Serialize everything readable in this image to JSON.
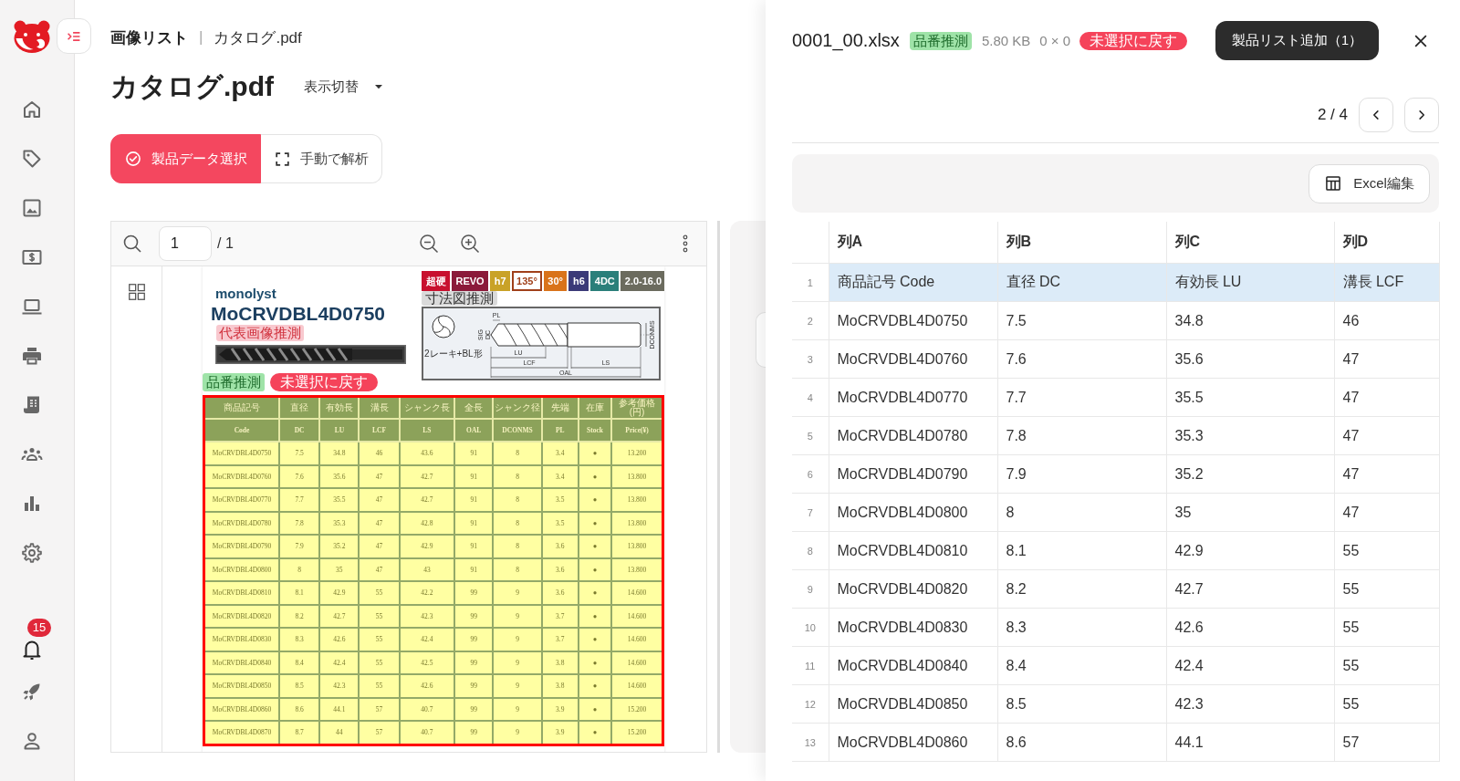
{
  "sidebar": {
    "notification_badge": "15"
  },
  "breadcrumb": {
    "parent": "画像リスト",
    "separator": "|",
    "current": "カタログ.pdf"
  },
  "header": {
    "title": "カタログ.pdf",
    "view_switch": "表示切替"
  },
  "mode_buttons": [
    {
      "label": "製品データ選択",
      "selected": true
    },
    {
      "label": "手動で解析",
      "selected": false
    }
  ],
  "pdf_viewer": {
    "page_input": "1",
    "page_total": "/ 1"
  },
  "catalog": {
    "brand": "monolyst",
    "product_code": "MoCRVDBL4D0750",
    "image_tag": "代表画像推測",
    "spec_badges": [
      {
        "text": "超硬",
        "color": "#c8102e",
        "kind": "solid"
      },
      {
        "text": "REVO",
        "color": "#8b1a3a",
        "kind": "solid"
      },
      {
        "text": "h7",
        "color": "#c9a227",
        "kind": "solid"
      },
      {
        "text": "135°",
        "color": "#a0401a",
        "kind": "outline"
      },
      {
        "text": "30°",
        "color": "#d9731a",
        "kind": "solid"
      },
      {
        "text": "h6",
        "color": "#3b3a78",
        "kind": "solid"
      },
      {
        "text": "4DC",
        "color": "#2a7f7a",
        "kind": "solid"
      },
      {
        "text": "2.0-16.0",
        "color": "#6b6b5e",
        "kind": "solid"
      }
    ],
    "drawing_tag": "寸法図推測",
    "drawing_labels": [
      "PL",
      "SIG",
      "DC",
      "DCONMS",
      "LU",
      "LCF",
      "LS",
      "OAL",
      "2レーキ+BL形"
    ],
    "part_tag": "品番推測",
    "reset_button": "未選択に戻す",
    "table": {
      "header_ja": [
        "商品記号",
        "直径",
        "有効長",
        "溝長",
        "シャンク長",
        "全長",
        "シャンク径",
        "先端",
        "在庫",
        "参考価格(円)"
      ],
      "header_en": [
        "Code",
        "DC",
        "LU",
        "LCF",
        "LS",
        "OAL",
        "DCONMS",
        "PL",
        "Stock",
        "Price(¥)"
      ],
      "rows": [
        [
          "MoCRVDBL4D0750",
          "7.5",
          "34.8",
          "46",
          "43.6",
          "91",
          "8",
          "3.4",
          "●",
          "13.200"
        ],
        [
          "MoCRVDBL4D0760",
          "7.6",
          "35.6",
          "47",
          "42.7",
          "91",
          "8",
          "3.4",
          "●",
          "13.800"
        ],
        [
          "MoCRVDBL4D0770",
          "7.7",
          "35.5",
          "47",
          "42.7",
          "91",
          "8",
          "3.5",
          "●",
          "13.800"
        ],
        [
          "MoCRVDBL4D0780",
          "7.8",
          "35.3",
          "47",
          "42.8",
          "91",
          "8",
          "3.5",
          "●",
          "13.800"
        ],
        [
          "MoCRVDBL4D0790",
          "7.9",
          "35.2",
          "47",
          "42.9",
          "91",
          "8",
          "3.6",
          "●",
          "13.800"
        ],
        [
          "MoCRVDBL4D0800",
          "8",
          "35",
          "47",
          "43",
          "91",
          "8",
          "3.6",
          "●",
          "13.800"
        ],
        [
          "MoCRVDBL4D0810",
          "8.1",
          "42.9",
          "55",
          "42.2",
          "99",
          "9",
          "3.6",
          "●",
          "14.600"
        ],
        [
          "MoCRVDBL4D0820",
          "8.2",
          "42.7",
          "55",
          "42.3",
          "99",
          "9",
          "3.7",
          "●",
          "14.600"
        ],
        [
          "MoCRVDBL4D0830",
          "8.3",
          "42.6",
          "55",
          "42.4",
          "99",
          "9",
          "3.7",
          "●",
          "14.600"
        ],
        [
          "MoCRVDBL4D0840",
          "8.4",
          "42.4",
          "55",
          "42.5",
          "99",
          "9",
          "3.8",
          "●",
          "14.600"
        ],
        [
          "MoCRVDBL4D0850",
          "8.5",
          "42.3",
          "55",
          "42.6",
          "99",
          "9",
          "3.8",
          "●",
          "14.600"
        ],
        [
          "MoCRVDBL4D0860",
          "8.6",
          "44.1",
          "57",
          "40.7",
          "99",
          "9",
          "3.9",
          "●",
          "15.200"
        ],
        [
          "MoCRVDBL4D0870",
          "8.7",
          "44",
          "57",
          "40.7",
          "99",
          "9",
          "3.9",
          "●",
          "15.200"
        ]
      ]
    }
  },
  "detail_panel": {
    "file_name": "0001_00.xlsx",
    "tag": "品番推測",
    "size": "5.80 KB",
    "dimensions": "0 × 0",
    "reset_button": "未選択に戻す",
    "add_button": "製品リスト追加（1）",
    "pagination": "2 / 4",
    "excel_button": "Excel編集",
    "sheet": {
      "columns": [
        "列A",
        "列B",
        "列C",
        "列D"
      ],
      "rows": [
        {
          "number": "1",
          "selected": true,
          "cells": [
            "商品記号 Code",
            "直径 DC",
            "有効長 LU",
            "溝長 LCF"
          ]
        },
        {
          "number": "2",
          "selected": false,
          "cells": [
            "MoCRVDBL4D0750",
            "7.5",
            "34.8",
            "46"
          ]
        },
        {
          "number": "3",
          "selected": false,
          "cells": [
            "MoCRVDBL4D0760",
            "7.6",
            "35.6",
            "47"
          ]
        },
        {
          "number": "4",
          "selected": false,
          "cells": [
            "MoCRVDBL4D0770",
            "7.7",
            "35.5",
            "47"
          ]
        },
        {
          "number": "5",
          "selected": false,
          "cells": [
            "MoCRVDBL4D0780",
            "7.8",
            "35.3",
            "47"
          ]
        },
        {
          "number": "6",
          "selected": false,
          "cells": [
            "MoCRVDBL4D0790",
            "7.9",
            "35.2",
            "47"
          ]
        },
        {
          "number": "7",
          "selected": false,
          "cells": [
            "MoCRVDBL4D0800",
            "8",
            "35",
            "47"
          ]
        },
        {
          "number": "8",
          "selected": false,
          "cells": [
            "MoCRVDBL4D0810",
            "8.1",
            "42.9",
            "55"
          ]
        },
        {
          "number": "9",
          "selected": false,
          "cells": [
            "MoCRVDBL4D0820",
            "8.2",
            "42.7",
            "55"
          ]
        },
        {
          "number": "10",
          "selected": false,
          "cells": [
            "MoCRVDBL4D0830",
            "8.3",
            "42.6",
            "55"
          ]
        },
        {
          "number": "11",
          "selected": false,
          "cells": [
            "MoCRVDBL4D0840",
            "8.4",
            "42.4",
            "55"
          ]
        },
        {
          "number": "12",
          "selected": false,
          "cells": [
            "MoCRVDBL4D0850",
            "8.5",
            "42.3",
            "55"
          ]
        },
        {
          "number": "13",
          "selected": false,
          "cells": [
            "MoCRVDBL4D0860",
            "8.6",
            "44.1",
            "57"
          ]
        }
      ]
    }
  }
}
